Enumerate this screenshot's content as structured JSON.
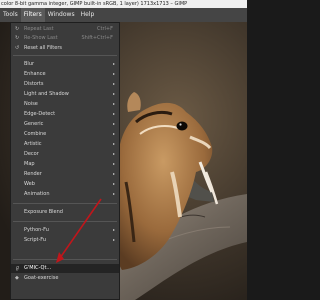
{
  "window": {
    "title": "color 8-bit gamma integer, GIMP built-in sRGB, 1 layer) 1713x1713 – GIMP"
  },
  "menubar": {
    "items": [
      "Tools",
      "Filters",
      "Windows",
      "Help"
    ],
    "active": "Filters"
  },
  "filters_menu": {
    "repeat_last": {
      "label": "Repeat Last",
      "shortcut": "Ctrl+F"
    },
    "reshow_last": {
      "label": "Re-Show Last",
      "shortcut": "Shift+Ctrl+F"
    },
    "reset_all": {
      "label": "Reset all Filters"
    },
    "submenus": [
      "Blur",
      "Enhance",
      "Distorts",
      "Light and Shadow",
      "Noise",
      "Edge-Detect",
      "Generic",
      "Combine",
      "Artistic",
      "Decor",
      "Map",
      "Render",
      "Web",
      "Animation"
    ],
    "exposure_blend": {
      "label": "Exposure Blend"
    },
    "scripting": [
      "Python-Fu",
      "Script-Fu"
    ],
    "gmic": {
      "label": "G'MIC-Qt..."
    },
    "goat": {
      "label": "Goat-exercise"
    }
  },
  "colors": {
    "menu_bg": "#3b3b3b",
    "menubar_bg": "#454545",
    "pointer_arrow": "#c0161b"
  }
}
